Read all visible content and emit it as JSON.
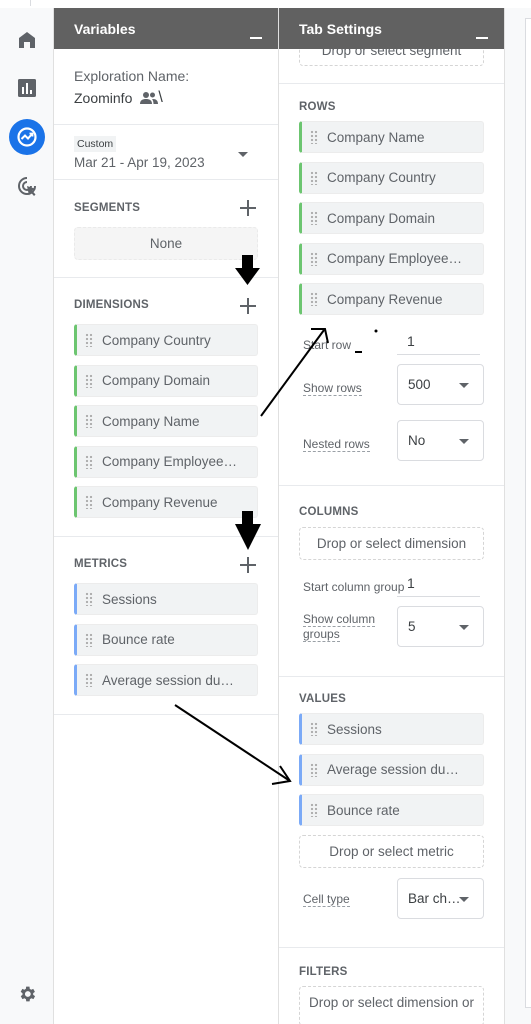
{
  "nav": {
    "items": [
      {
        "name": "home",
        "icon": "home-icon",
        "active": false
      },
      {
        "name": "reports",
        "icon": "bar-chart-icon",
        "active": false
      },
      {
        "name": "explore",
        "icon": "explore-icon",
        "active": true
      },
      {
        "name": "advertising",
        "icon": "cursor-target-icon",
        "active": false
      }
    ],
    "settings_icon": "gear-icon",
    "active_color": "#1a73e8"
  },
  "variables": {
    "title": "Variables",
    "exploration_name_label": "Exploration Name:",
    "exploration_name": "Zoominfo",
    "shared_icon": "people-icon",
    "date_range": {
      "badge": "Custom",
      "value": "Mar 21 - Apr 19, 2023"
    },
    "segments": {
      "title": "SEGMENTS",
      "value": "None"
    },
    "dimensions": {
      "title": "DIMENSIONS",
      "items": [
        "Company Country",
        "Company Domain",
        "Company Name",
        "Company Employee…",
        "Company Revenue"
      ]
    },
    "metrics": {
      "title": "METRICS",
      "items": [
        "Sessions",
        "Bounce rate",
        "Average session du…"
      ]
    }
  },
  "tab_settings": {
    "title": "Tab Settings",
    "segment_dropzone": "Drop or select segment",
    "rows": {
      "title": "ROWS",
      "items": [
        "Company Name",
        "Company Country",
        "Company Domain",
        "Company Employee…",
        "Company Revenue"
      ],
      "start_row_label": "Start row",
      "start_row_value": "1",
      "show_rows_label": "Show rows",
      "show_rows_value": "500",
      "nested_rows_label": "Nested rows",
      "nested_rows_value": "No"
    },
    "columns": {
      "title": "COLUMNS",
      "dropzone": "Drop or select dimension",
      "start_group_label": "Start column group",
      "start_group_value": "1",
      "show_groups_label_1": "Show column",
      "show_groups_label_2": "groups",
      "show_groups_value": "5"
    },
    "values": {
      "title": "VALUES",
      "items": [
        "Sessions",
        "Average session du…",
        "Bounce rate"
      ],
      "dropzone": "Drop or select metric",
      "cell_type_label": "Cell type",
      "cell_type_value": "Bar ch…"
    },
    "filters": {
      "title": "FILTERS",
      "dropzone": "Drop or select dimension or"
    }
  },
  "colors": {
    "header_bg": "#616161",
    "dimension_accent": "#6cc570",
    "metric_accent": "#7baaf7"
  }
}
